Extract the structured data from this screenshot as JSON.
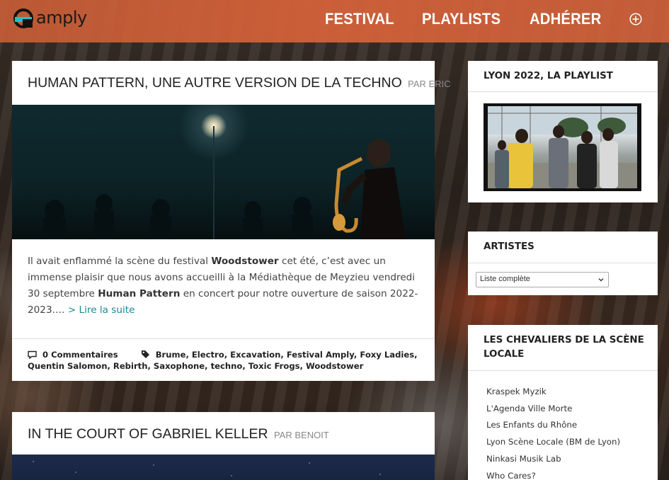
{
  "header": {
    "logo_text": "amply",
    "nav": [
      "FESTIVAL",
      "PLAYLISTS",
      "ADHÉRER"
    ],
    "brand_color": "#d9623a"
  },
  "posts": [
    {
      "title": "HUMAN PATTERN, UNE AUTRE VERSION DE LA TECHNO",
      "by": "PAR ERIC",
      "excerpt_1": "Il avait enflammé la scène du festival ",
      "excerpt_bold_1": "Woodstower",
      "excerpt_2": " cet été, c’est avec un immense plaisir que nous avons accueilli à la Médiathèque de Meyzieu vendredi 30 septembre ",
      "excerpt_bold_2": "Human Pattern",
      "excerpt_3": " en concert pour notre ouverture de saison 2022-2023.… ",
      "read_more": "> Lire la suite",
      "comments": "0 Commentaires",
      "tags": "Brume, Electro, Excavation, Festival Amply, Foxy Ladies, Quentin Salomon, Rebirth, Saxophone, techno, Toxic Frogs, Woodstower"
    },
    {
      "title": "IN THE COURT OF GABRIEL KELLER",
      "by": "PAR BENOIT"
    }
  ],
  "sidebar": {
    "playlist": {
      "title": "LYON 2022, LA PLAYLIST"
    },
    "artists": {
      "title": "ARTISTES",
      "select_value": "Liste complète"
    },
    "chevaliers": {
      "title_line1": "LES CHEVALIERS DE LA SCÈNE",
      "title_line2": "LOCALE",
      "links": [
        "Kraspek Myzik",
        "L'Agenda Ville Morte",
        "Les Enfants du Rhône",
        "Lyon Scène Locale (BM de Lyon)",
        "Ninkasi Musik Lab",
        "Who Cares?"
      ]
    }
  }
}
